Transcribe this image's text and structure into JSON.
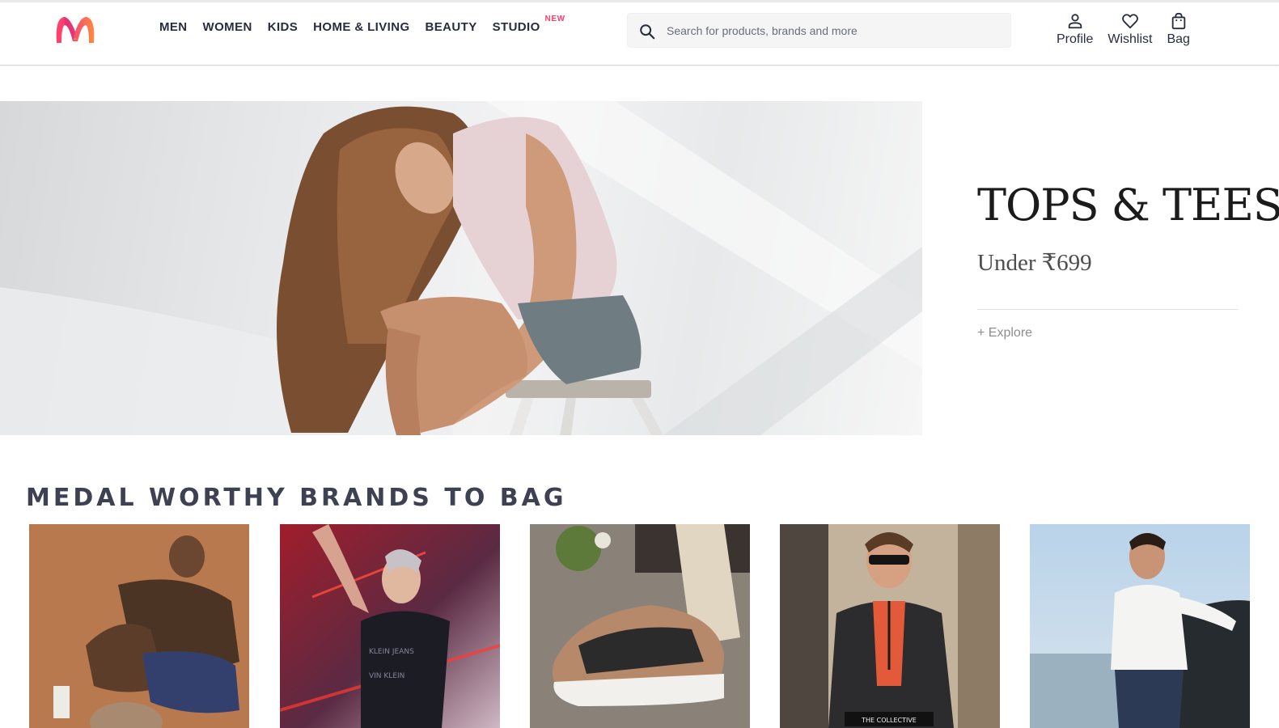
{
  "header": {
    "logo_icon": "myntra-logo-icon",
    "nav": [
      "MEN",
      "WOMEN",
      "KIDS",
      "HOME & LIVING",
      "BEAUTY",
      "STUDIO"
    ],
    "nav_badge": "NEW",
    "search": {
      "placeholder": "Search for products, brands and more",
      "icon": "search-icon"
    },
    "actions": [
      {
        "label": "Profile",
        "icon": "person-icon"
      },
      {
        "label": "Wishlist",
        "icon": "heart-icon"
      },
      {
        "label": "Bag",
        "icon": "bag-icon"
      }
    ]
  },
  "hero": {
    "title": "TOPS & TEES",
    "subtitle": "Under ₹699",
    "link": "+ Explore"
  },
  "brands": {
    "title": "MEDAL WORTHY BRANDS TO BAG",
    "card_overlay_text": "THE COLLECTIVE"
  },
  "colors": {
    "accent": "#ff3f6c",
    "text": "#282c3f",
    "search_bg": "#f5f5f6"
  }
}
